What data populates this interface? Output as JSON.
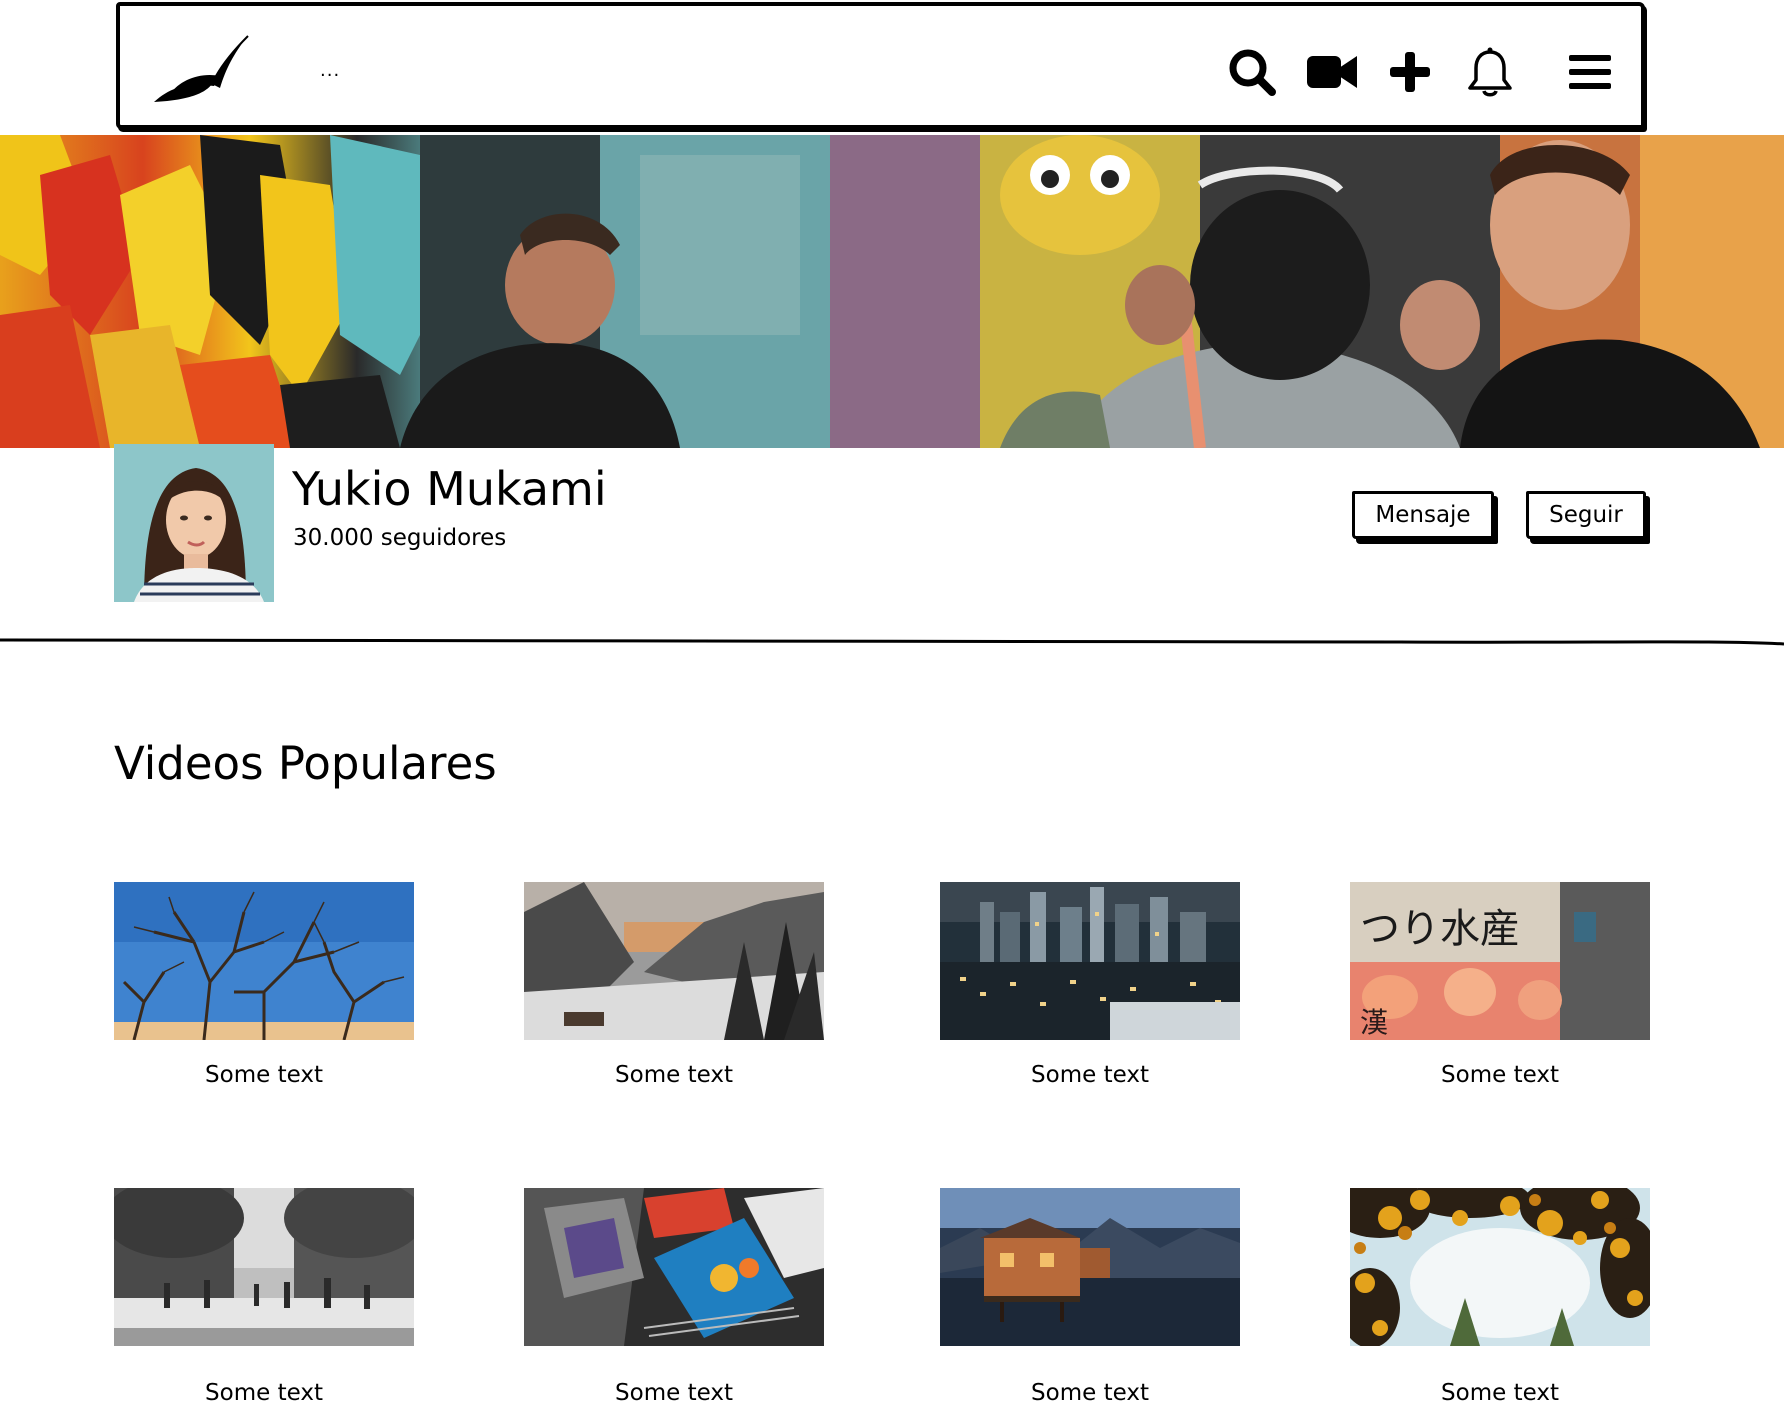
{
  "header": {
    "nav_text": "...",
    "icons": [
      "logo-icon",
      "search-icon",
      "video-camera-icon",
      "plus-icon",
      "bell-icon",
      "menu-icon"
    ]
  },
  "profile": {
    "name": "Yukio Mukami",
    "followers": "30.000 seguidores",
    "message_label": "Mensaje",
    "follow_label": "Seguir"
  },
  "videos": {
    "title": "Videos Populares",
    "items": [
      {
        "caption": "Some text"
      },
      {
        "caption": "Some text"
      },
      {
        "caption": "Some text"
      },
      {
        "caption": "Some text"
      },
      {
        "caption": "Some text"
      },
      {
        "caption": "Some text"
      },
      {
        "caption": "Some text"
      },
      {
        "caption": "Some text"
      }
    ]
  }
}
